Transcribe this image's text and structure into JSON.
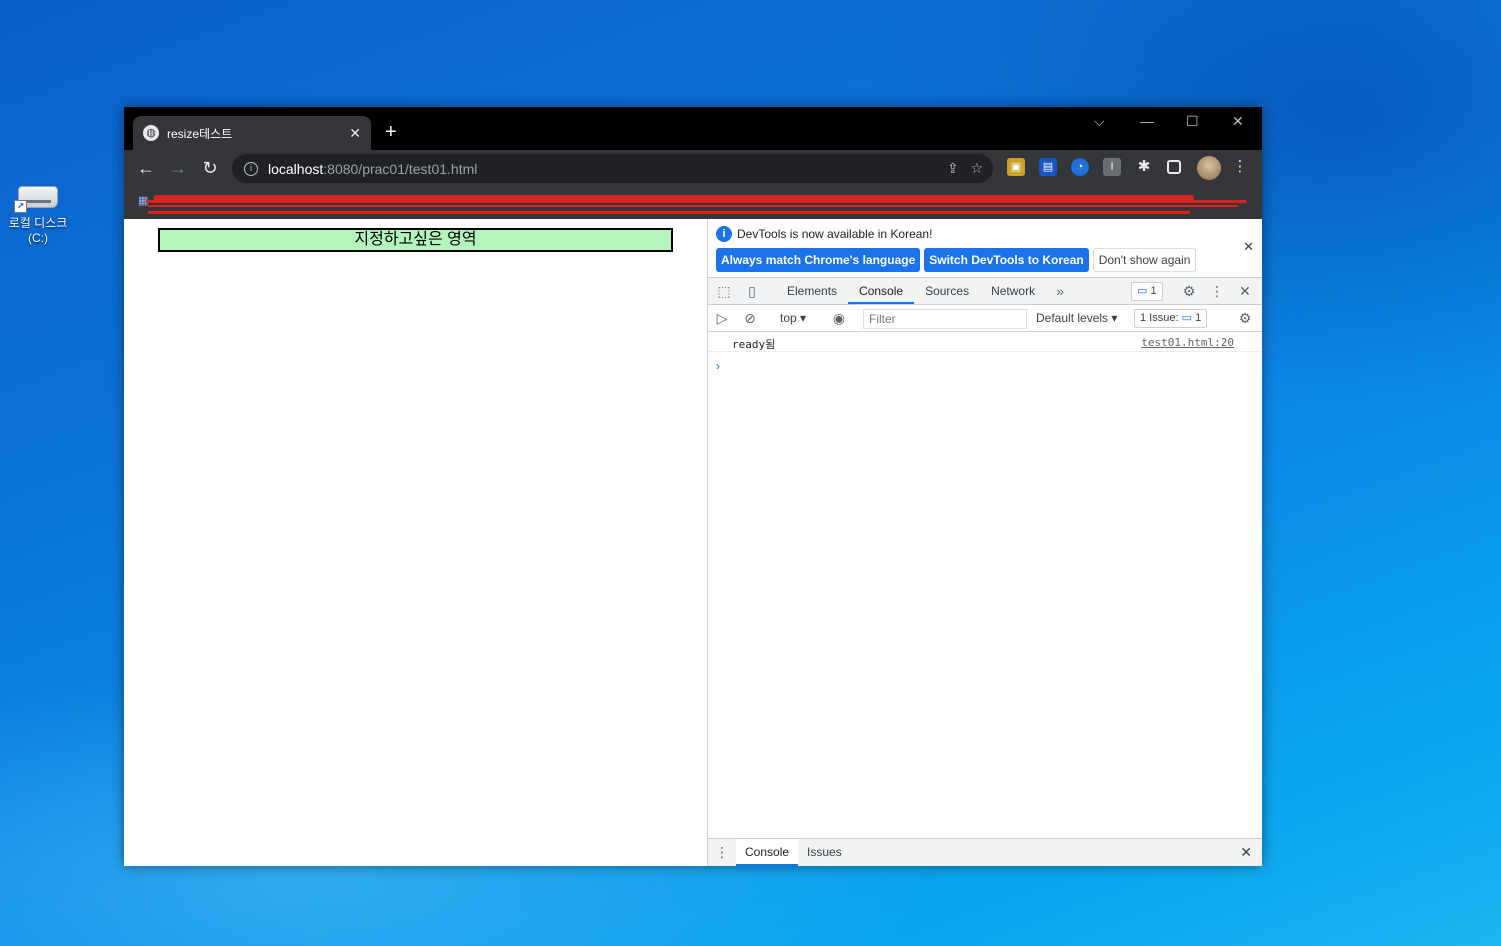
{
  "desktop": {
    "icon_label": "로컬 디스크\n(C:)"
  },
  "browser": {
    "tab": {
      "title": "resize테스트"
    },
    "window_controls": {
      "tab_search": "⌵",
      "minimize": "—",
      "maximize": "☐",
      "close": "✕"
    },
    "url": {
      "host": "localhost",
      "path": ":8080/prac01/test01.html"
    },
    "nav": {
      "back": "←",
      "forward": "→",
      "reload": "↻"
    }
  },
  "page": {
    "box_text": "지정하고싶은 영역",
    "box_color": "#b3f5bd"
  },
  "devtools": {
    "infobar": {
      "message": "DevTools is now available in Korean!",
      "btn_always_match": "Always match Chrome's language",
      "btn_switch": "Switch DevTools to Korean",
      "btn_dont_show": "Don't show again"
    },
    "tabs": [
      "Elements",
      "Console",
      "Sources",
      "Network"
    ],
    "active_tab": "Console",
    "issues_badge_count": "1",
    "console_toolbar": {
      "context": "top",
      "filter_placeholder": "Filter",
      "levels": "Default levels",
      "issues_label": "1 Issue:",
      "issues_count": "1"
    },
    "log": {
      "message": "ready됨",
      "source": "test01.html:20"
    },
    "drawer_tabs": [
      "Console",
      "Issues"
    ]
  },
  "colors": {
    "accent": "#1a73e8",
    "desktop": "#0a74d8"
  }
}
